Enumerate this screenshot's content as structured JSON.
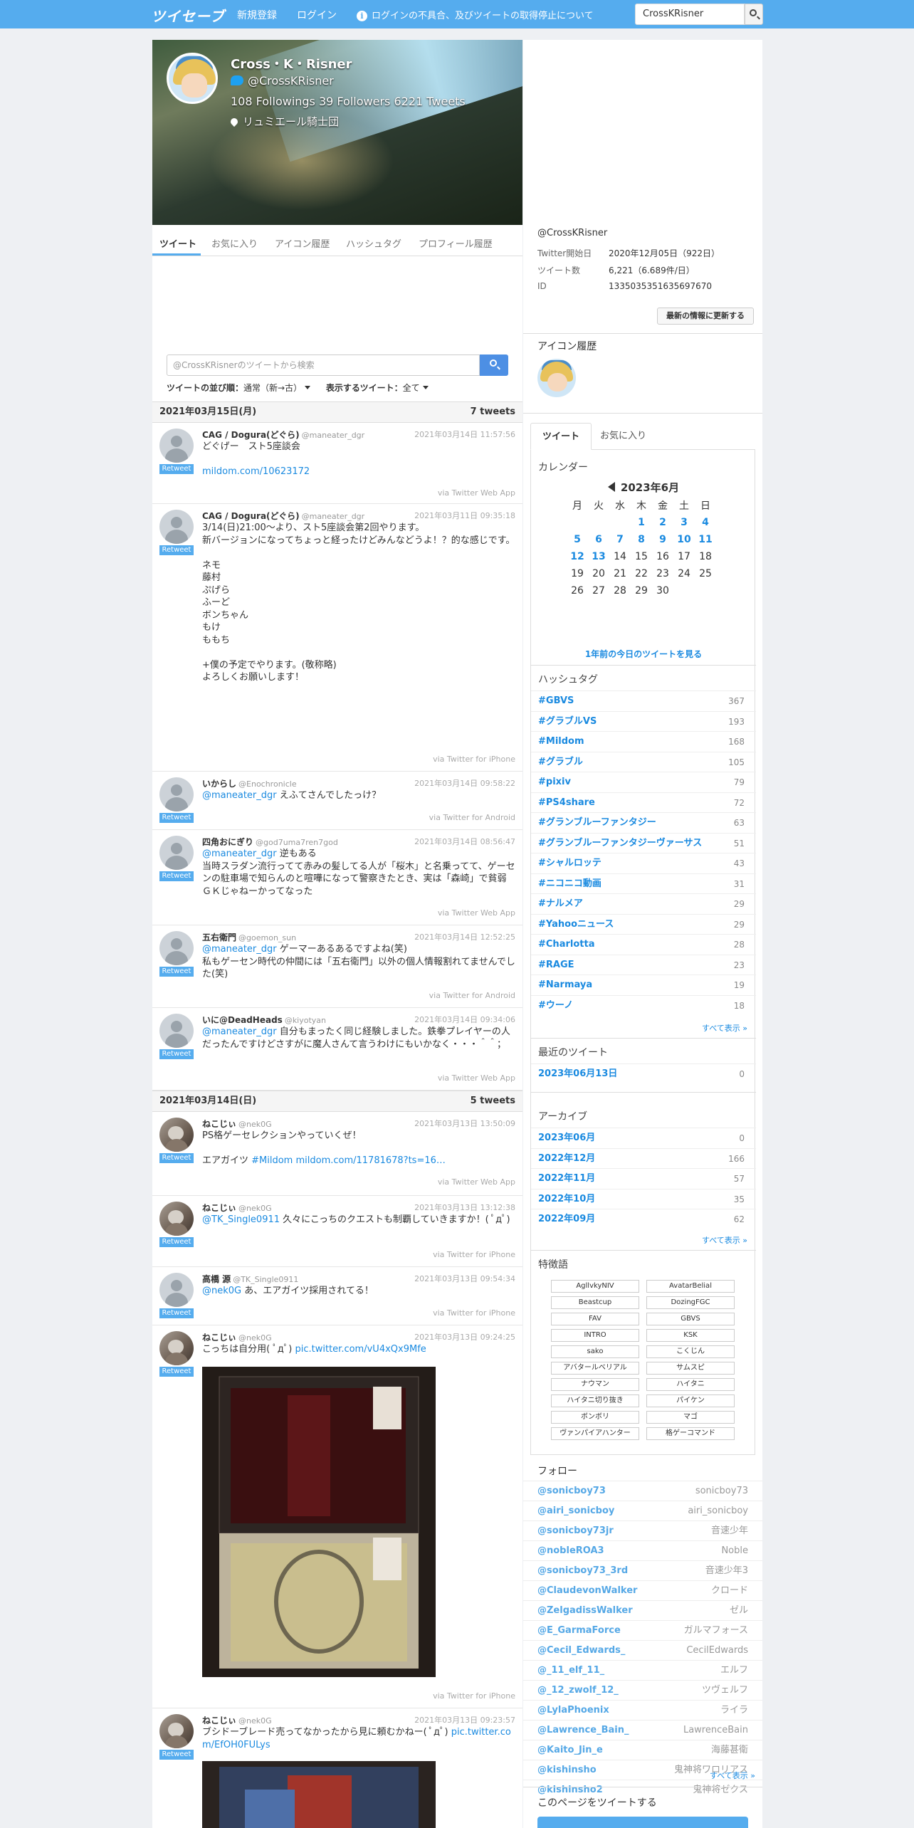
{
  "header": {
    "logo": "ツイセーブ",
    "nav_register": "新規登録",
    "nav_login": "ログイン",
    "notice": "ログインの不具合、及びツイートの取得停止について",
    "search_value": "CrossKRisner"
  },
  "profile": {
    "name": "Cross・K・Risner",
    "handle": "@CrossKRisner",
    "stats": "108 Followings   39 Followers   6221 Tweets",
    "location": "リュミエール騎士団",
    "tabs": [
      "ツイート",
      "お気に入り",
      "アイコン履歴",
      "ハッシュタグ",
      "プロフィール履歴"
    ]
  },
  "timeline": {
    "search_placeholder": "@CrossKRisnerのツイートから検索",
    "sort_label": "ツイートの並び順：",
    "sort_value": "通常（新→古）",
    "show_label": "表示するツイート：",
    "show_value": "全て",
    "days": [
      {
        "date": "2021年03月15日(月)",
        "count": "7 tweets"
      },
      {
        "date": "2021年03月14日(日)",
        "count": "5 tweets"
      }
    ],
    "retweet_label": "Retweet",
    "tweets": [
      {
        "name": "CAG / Dogura(どぐら)",
        "screen": "@maneater_dgr",
        "date": "2021年03月14日 11:57:56",
        "text": "どぐげー　スト5座談会",
        "link": "mildom.com/10623172",
        "via": "via Twitter Web App"
      },
      {
        "name": "CAG / Dogura(どぐら)",
        "screen": "@maneater_dgr",
        "date": "2021年03月11日 09:35:18",
        "text": "3/14(日)21:00〜より、スト5座談会第2回やります。\n新バージョンになってちょっと経ったけどみんなどうよ！？的な感じです。\n\nネモ\n藤村\nぷげら\nふーど\nボンちゃん\nもけ\nももち\n\n+僕の予定でやります。(敬称略)\nよろしくお願いします！",
        "via": "via Twitter for iPhone"
      },
      {
        "name": "いからし",
        "screen": "@Enochronicle",
        "date": "2021年03月14日 09:58:22",
        "mention": "@maneater_dgr",
        "text": " えふてさんでしたっけ？",
        "via": "via Twitter for Android"
      },
      {
        "name": "四角おにぎり",
        "screen": "@god7uma7ren7god",
        "date": "2021年03月14日 08:56:47",
        "mention": "@maneater_dgr",
        "text": " 逆もある\n当時スラダン流行ってて赤みの髪してる人が「桜木」と名乗ってて、ゲーセンの駐車場で知らんのと喧嘩になって警察きたとき、実は「森崎」で貧弱ＧＫじゃねーかってなった",
        "via": "via Twitter Web App"
      },
      {
        "name": "五右衛門",
        "screen": "@goemon_sun",
        "date": "2021年03月14日 12:52:25",
        "mention": "@maneater_dgr",
        "text": " ゲーマーあるあるですよね(笑)\n私もゲーセン時代の仲間には「五右衛門」以外の個人情報割れてませんでした(笑)",
        "via": "via Twitter for Android"
      },
      {
        "name": "いに@DeadHeads",
        "screen": "@kiyotyan",
        "date": "2021年03月14日 09:34:06",
        "mention": "@maneater_dgr",
        "text": " 自分もまったく同じ経験しました。鉄拳プレイヤーの人だったんですけどさすがに魔人さんて言うわけにもいかなく・・・＾＾；",
        "via": "via Twitter Web App"
      },
      {
        "name": "ねこじぃ",
        "screen": "@nek0G",
        "date": "2021年03月13日 13:50:09",
        "text": "PS格ゲーセレクションやっていくぜ！\n\nエアガイツ ",
        "link": "#Mildom mildom.com/11781678?ts=16…",
        "via": "via Twitter Web App"
      },
      {
        "name": "ねこじぃ",
        "screen": "@nek0G",
        "date": "2021年03月13日 13:12:38",
        "mention": "@TK_Single0911",
        "text": " 久々にこっちのクエストも制覇していきますか！( ﾟдﾟ)",
        "via": "via Twitter for iPhone"
      },
      {
        "name": "高橋 源",
        "screen": "@TK_Single0911",
        "date": "2021年03月13日 09:54:34",
        "mention": "@nek0G",
        "text": " あ、エアガイツ採用されてる！",
        "via": "via Twitter for iPhone"
      },
      {
        "name": "ねこじぃ",
        "screen": "@nek0G",
        "date": "2021年03月13日 09:24:25",
        "text": "こっちは自分用( ﾟдﾟ) ",
        "link": "pic.twitter.com/vU4xQx9Mfe",
        "via": "via Twitter for iPhone"
      },
      {
        "name": "ねこじぃ",
        "screen": "@nek0G",
        "date": "2021年03月13日 09:23:57",
        "text": "ブシドーブレード売ってなかったから見に頼むかねー( ﾟдﾟ) ",
        "link": "pic.twitter.com/EfOH0FULys"
      }
    ]
  },
  "sidebar": {
    "handle": "@CrossKRisner",
    "info": [
      {
        "k": "Twitter開始日",
        "v": "2020年12月05日（922日）"
      },
      {
        "k": "ツイート数",
        "v": "6,221（6.689件/日）"
      },
      {
        "k": "ID",
        "v": "1335035351635697670"
      }
    ],
    "update_button": "最新の情報に更新する",
    "icon_history_title": "アイコン履歴",
    "tabs": [
      "ツイート",
      "お気に入り"
    ],
    "calendar_title": "カレンダー",
    "calendar_month": "2023年6月",
    "weekdays": [
      "月",
      "火",
      "水",
      "木",
      "金",
      "土",
      "日"
    ],
    "calendar_rows": [
      [
        "",
        "",
        "",
        "1",
        "2",
        "3",
        "4"
      ],
      [
        "5",
        "6",
        "7",
        "8",
        "9",
        "10",
        "11"
      ],
      [
        "12",
        "13",
        "14",
        "15",
        "16",
        "17",
        "18"
      ],
      [
        "19",
        "20",
        "21",
        "22",
        "23",
        "24",
        "25"
      ],
      [
        "26",
        "27",
        "28",
        "29",
        "30",
        "",
        ""
      ]
    ],
    "calendar_linked": [
      "1",
      "2",
      "3",
      "4",
      "5",
      "6",
      "7",
      "8",
      "9",
      "10",
      "11",
      "12",
      "13"
    ],
    "calendar_link": "1年前の今日のツイートを見る",
    "hashtag_title": "ハッシュタグ",
    "hashtags": [
      {
        "n": "#GBVS",
        "c": "367"
      },
      {
        "n": "#グラブルVS",
        "c": "193"
      },
      {
        "n": "#Mildom",
        "c": "168"
      },
      {
        "n": "#グラブル",
        "c": "105"
      },
      {
        "n": "#pixiv",
        "c": "79"
      },
      {
        "n": "#PS4share",
        "c": "72"
      },
      {
        "n": "#グランブルーファンタジー",
        "c": "63"
      },
      {
        "n": "#グランブルーファンタジーヴァーサス",
        "c": "51"
      },
      {
        "n": "#シャルロッテ",
        "c": "43"
      },
      {
        "n": "#ニコニコ動画",
        "c": "31"
      },
      {
        "n": "#ナルメア",
        "c": "29"
      },
      {
        "n": "#Yahooニュース",
        "c": "29"
      },
      {
        "n": "#Charlotta",
        "c": "28"
      },
      {
        "n": "#RAGE",
        "c": "23"
      },
      {
        "n": "#Narmaya",
        "c": "19"
      },
      {
        "n": "#ウーノ",
        "c": "18"
      }
    ],
    "show_all": "すべて表示 »",
    "recent_title": "最近のツイート",
    "recent": [
      {
        "n": "2023年06月13日",
        "c": "0"
      }
    ],
    "archive_title": "アーカイブ",
    "archive": [
      {
        "n": "2023年06月",
        "c": "0"
      },
      {
        "n": "2022年12月",
        "c": "166"
      },
      {
        "n": "2022年11月",
        "c": "57"
      },
      {
        "n": "2022年10月",
        "c": "35"
      },
      {
        "n": "2022年09月",
        "c": "62"
      }
    ],
    "keywords_title": "特徴語",
    "keywords": [
      "AgllvkyNIV",
      "AvatarBelial",
      "Beastcup",
      "DozingFGC",
      "FAV",
      "GBVS",
      "INTRO",
      "KSK",
      "sako",
      "こくじん",
      "アバタールベリアル",
      "サムスピ",
      "ナウマン",
      "ハイタニ",
      "ハイタニ切り抜き",
      "パイケン",
      "ボンボリ",
      "マゴ",
      "ヴァンパイアハンター",
      "格ゲーコマンド"
    ],
    "follow_title": "フォロー",
    "follows": [
      {
        "h": "@sonicboy73",
        "n": "sonicboy73"
      },
      {
        "h": "@airi_sonicboy",
        "n": "airi_sonicboy"
      },
      {
        "h": "@sonicboy73jr",
        "n": "音速少年"
      },
      {
        "h": "@nobleROA3",
        "n": "Noble"
      },
      {
        "h": "@sonicboy73_3rd",
        "n": "音速少年3"
      },
      {
        "h": "@ClaudevonWalker",
        "n": "クロード"
      },
      {
        "h": "@ZelgadissWalker",
        "n": "ゼル"
      },
      {
        "h": "@E_GarmaForce",
        "n": "ガルマフォース"
      },
      {
        "h": "@Cecil_Edwards_",
        "n": "CecilEdwards"
      },
      {
        "h": "@_11_elf_11_",
        "n": "エルフ"
      },
      {
        "h": "@_12_zwolf_12_",
        "n": "ツヴェルフ"
      },
      {
        "h": "@LylaPhoenix",
        "n": "ライラ"
      },
      {
        "h": "@Lawrence_Bain_",
        "n": "LawrenceBain"
      },
      {
        "h": "@Kaito_Jin_e",
        "n": "海藤甚衛"
      },
      {
        "h": "@kishinsho",
        "n": "鬼神将ワロリアス"
      },
      {
        "h": "@kishinsho2",
        "n": "鬼神将ゼクス"
      }
    ],
    "share_title": "このページをツイートする"
  }
}
